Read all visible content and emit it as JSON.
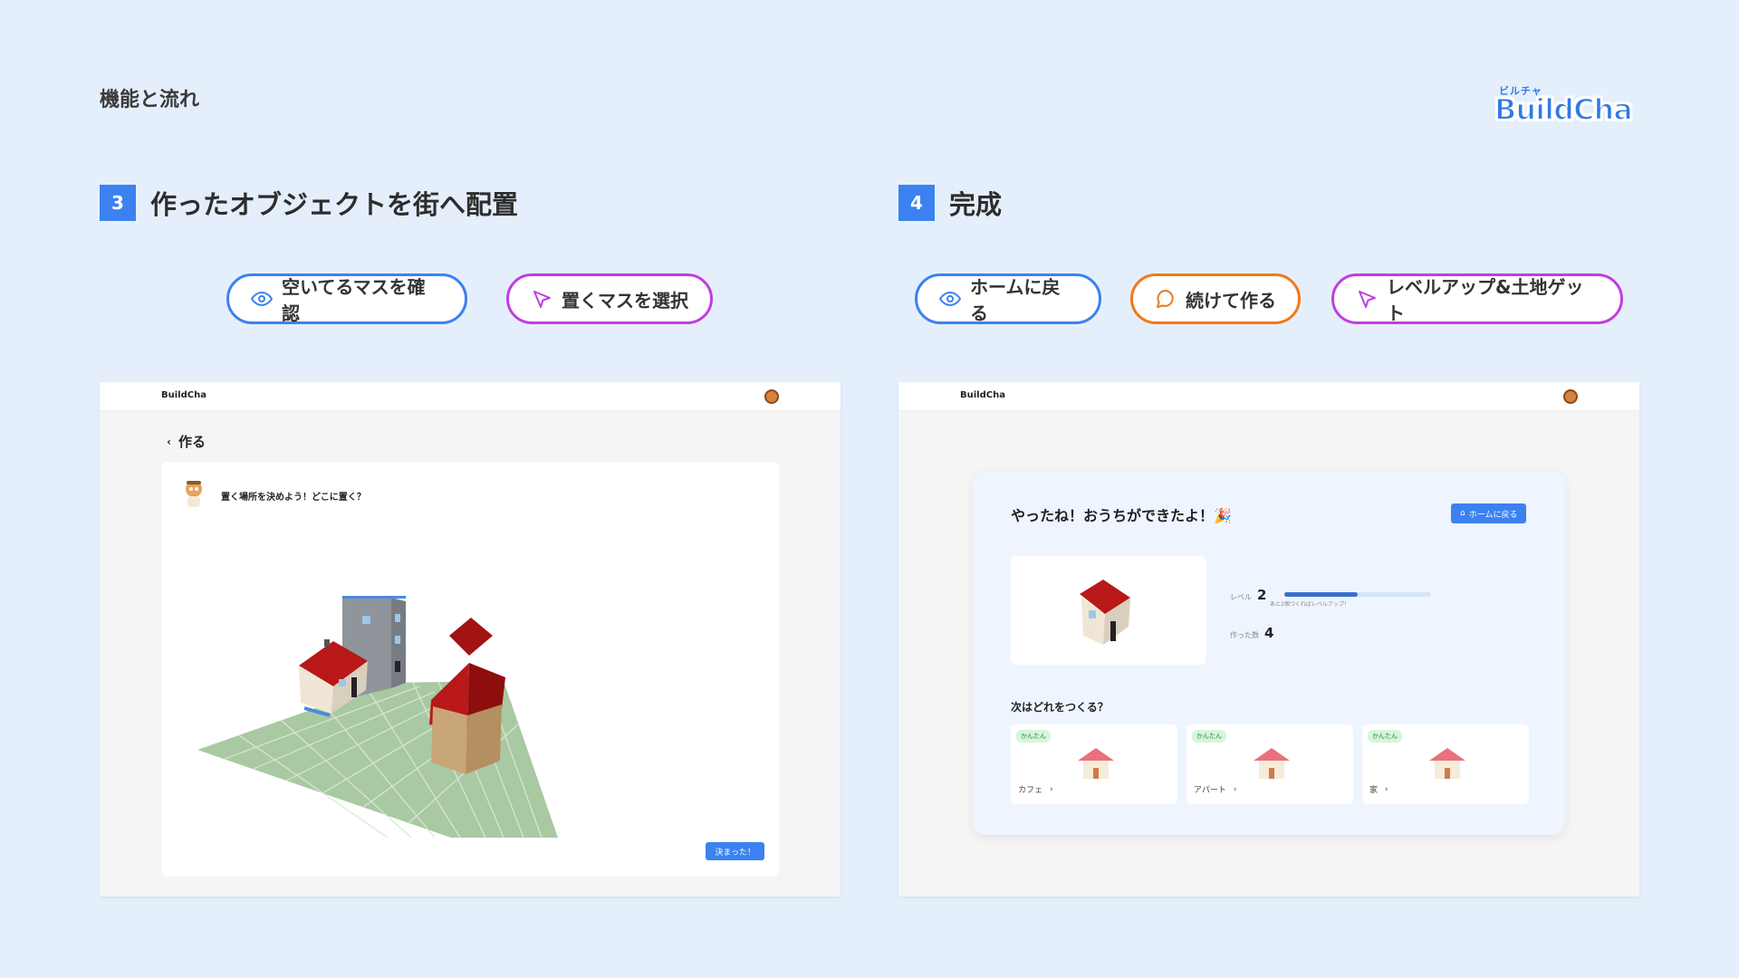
{
  "page": {
    "title": "機能と流れ"
  },
  "logo": {
    "ruby": "ビルチャ",
    "text": "BuildCha"
  },
  "steps": [
    {
      "num": "3",
      "title": "作ったオブジェクトを街へ配置"
    },
    {
      "num": "4",
      "title": "完成"
    }
  ],
  "actions_step3": [
    {
      "label": "空いてるマスを確認",
      "icon": "eye-icon",
      "color": "#3b82f0"
    },
    {
      "label": "置くマスを選択",
      "icon": "cursor-icon",
      "color": "#c03ee0"
    }
  ],
  "actions_step4": [
    {
      "label": "ホームに戻る",
      "icon": "eye-icon",
      "color": "#3b82f0"
    },
    {
      "label": "続けて作る",
      "icon": "chat-bubble-icon",
      "color": "#f07a18"
    },
    {
      "label": "レベルアップ&土地ゲット",
      "icon": "cursor-icon",
      "color": "#c03ee0"
    }
  ],
  "panel3": {
    "brand": "BuildCha",
    "back_label": "作る",
    "prompt": "置く場所を決めよう！どこに置く？",
    "decide_button": "決まった！"
  },
  "panel4": {
    "brand": "BuildCha",
    "title": "やったね！おうちができたよ！🎉",
    "home_button": "ホームに戻る",
    "level_label": "レベル",
    "level_value": "2",
    "level_hint": "あと2個つくればレベルアップ！",
    "level_progress": 0.5,
    "made_label": "作った数",
    "made_value": "4",
    "next_title": "次はどれをつくる？",
    "next_items": [
      {
        "badge": "かんたん",
        "label": "カフェ"
      },
      {
        "badge": "かんたん",
        "label": "アパート"
      },
      {
        "badge": "かんたん",
        "label": "家"
      }
    ]
  },
  "colors": {
    "accent": "#3b82f0",
    "purple": "#c03ee0",
    "orange": "#f07a18",
    "background": "#e5effc"
  }
}
